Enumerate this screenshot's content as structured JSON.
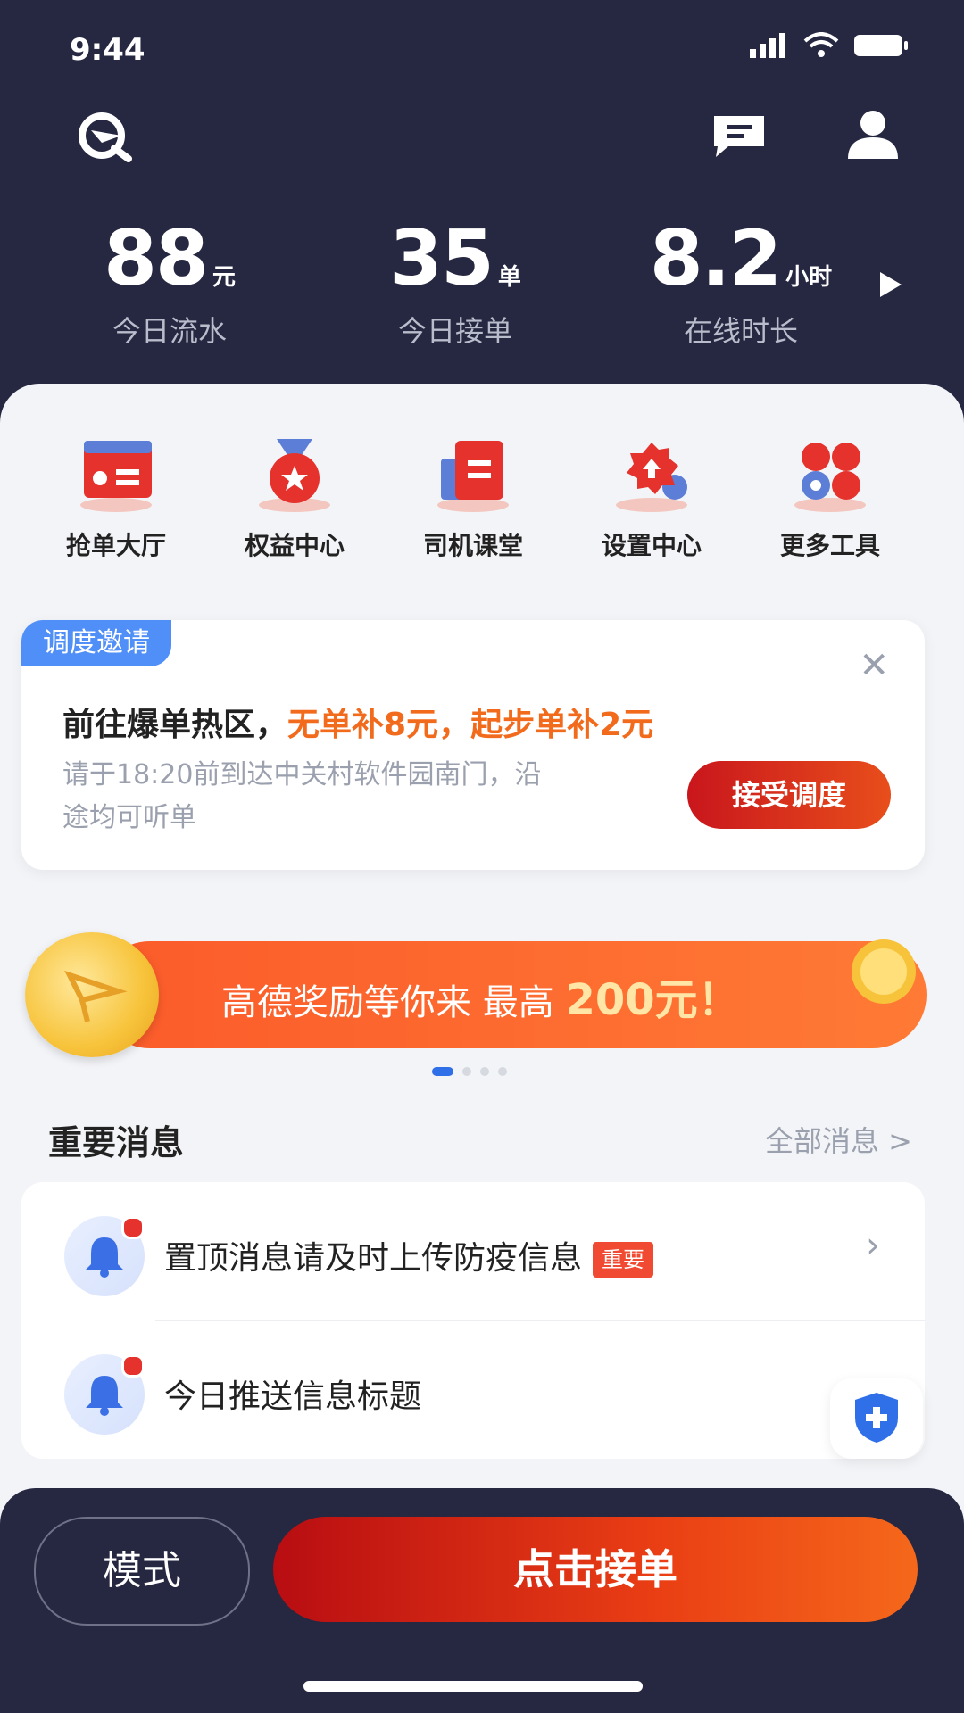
{
  "status_bar": {
    "time": "9:44"
  },
  "top_bar": {
    "logo_icon": "logo-icon",
    "message_icon": "message-icon",
    "profile_icon": "profile-icon"
  },
  "stats": [
    {
      "value": "88",
      "unit": "元",
      "label": "今日流水"
    },
    {
      "value": "35",
      "unit": "单",
      "label": "今日接单"
    },
    {
      "value": "8.2",
      "unit": "小时",
      "label": "在线时长"
    }
  ],
  "tools": [
    {
      "label": "抢单大厅",
      "icon": "order-hall-icon"
    },
    {
      "label": "权益中心",
      "icon": "medal-icon"
    },
    {
      "label": "司机课堂",
      "icon": "book-icon"
    },
    {
      "label": "设置中心",
      "icon": "gear-icon"
    },
    {
      "label": "更多工具",
      "icon": "more-tools-icon"
    }
  ],
  "dispatch": {
    "tag": "调度邀请",
    "title_prefix": "前往爆单热区，",
    "title_highlight": "无单补8元，起步单补2元",
    "description": "请于18:20前到达中关村软件园南门，沿途均可听单",
    "accept_label": "接受调度",
    "close_symbol": "✕"
  },
  "banner": {
    "text": "高德奖励等你来 最高",
    "amount": "200元！"
  },
  "carousel": {
    "count": 4,
    "active": 0
  },
  "messages_section": {
    "title": "重要消息",
    "link": "全部消息 >"
  },
  "messages": [
    {
      "text": "置顶消息请及时上传防疫信息",
      "badge": "重要"
    },
    {
      "text": "今日推送信息标题",
      "badge": ""
    }
  ],
  "bottom": {
    "mode_label": "模式",
    "accept_label": "点击接单"
  },
  "colors": {
    "header_bg": "#262741",
    "accent_red": "#c9161c",
    "accent_orange": "#f26a1b",
    "blue": "#4f8ff7"
  }
}
